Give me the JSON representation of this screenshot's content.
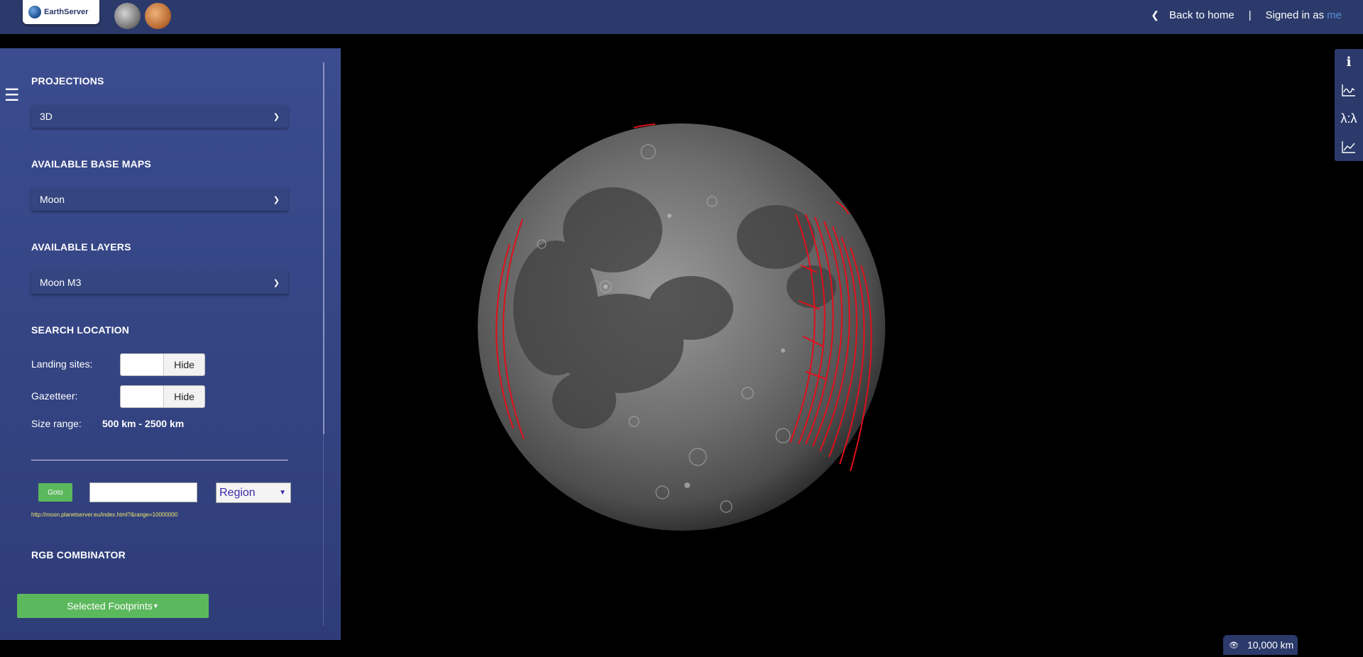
{
  "brand": {
    "logo_text": "EarthServer"
  },
  "nav": {
    "back_label": "Back to home",
    "separator": "|",
    "signed_in_label": "Signed in as",
    "user": "me"
  },
  "sidebar": {
    "projections": {
      "title": "PROJECTIONS",
      "selected": "3D"
    },
    "base_maps": {
      "title": "AVAILABLE BASE MAPS",
      "selected": "Moon"
    },
    "layers": {
      "title": "AVAILABLE LAYERS",
      "selected": "Moon M3"
    },
    "search": {
      "title": "SEARCH LOCATION",
      "landing_label": "Landing sites:",
      "landing_toggle": "Hide",
      "gazetteer_label": "Gazetteer:",
      "gazetteer_toggle": "Hide",
      "size_label": "Size range:",
      "size_value": "500 km - 2500 km",
      "goto_label": "Goto",
      "goto_value": "",
      "region_selected": "Region",
      "url": "http://moon.planetserver.eu/index.html?&range=10000000"
    },
    "rgb": {
      "title": "RGB COMBINATOR"
    },
    "footprints_button": "Selected Footprints"
  },
  "view": {
    "range_label": "10,000 km"
  },
  "colors": {
    "navbar": "#2b3a6b",
    "sidebar": "#3b4c8f",
    "green": "#5cb85c",
    "footprint_red": "#e0101a"
  },
  "icons": {
    "menu": "hamburger-icon",
    "back": "chevron-left-icon",
    "range": "eye-icon",
    "toolbar": [
      "info-icon",
      "spectrum-icon",
      "ratio-icon",
      "line-chart-icon"
    ]
  }
}
